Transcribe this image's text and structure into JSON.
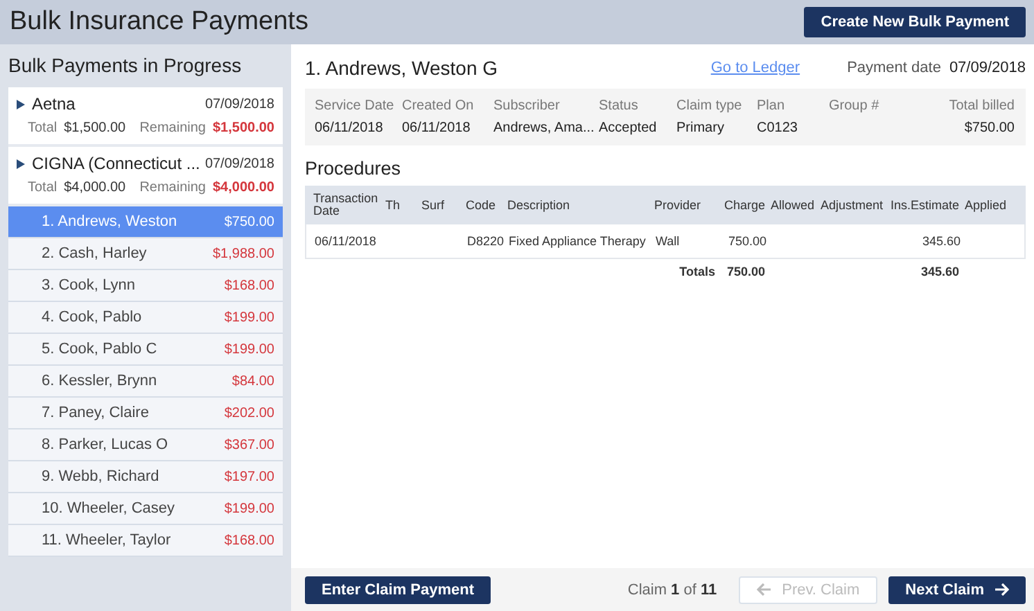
{
  "header": {
    "title": "Bulk Insurance Payments",
    "create_button": "Create New Bulk Payment"
  },
  "sidebar": {
    "title": "Bulk Payments in Progress",
    "groups": [
      {
        "name": "Aetna",
        "date": "07/09/2018",
        "total_label": "Total",
        "total": "$1,500.00",
        "remaining_label": "Remaining",
        "remaining": "$1,500.00",
        "expanded": false
      },
      {
        "name": "CIGNA (Connecticut ...",
        "date": "07/09/2018",
        "total_label": "Total",
        "total": "$4,000.00",
        "remaining_label": "Remaining",
        "remaining": "$4,000.00",
        "expanded": false
      }
    ],
    "claims": [
      {
        "name": "1. Andrews, Weston",
        "amount": "$750.00",
        "selected": true
      },
      {
        "name": "2. Cash, Harley",
        "amount": "$1,988.00",
        "selected": false
      },
      {
        "name": "3. Cook, Lynn",
        "amount": "$168.00",
        "selected": false
      },
      {
        "name": "4. Cook, Pablo",
        "amount": "$199.00",
        "selected": false
      },
      {
        "name": "5. Cook, Pablo C",
        "amount": "$199.00",
        "selected": false
      },
      {
        "name": "6. Kessler, Brynn",
        "amount": "$84.00",
        "selected": false
      },
      {
        "name": "7. Paney, Claire",
        "amount": "$202.00",
        "selected": false
      },
      {
        "name": "8. Parker, Lucas O",
        "amount": "$367.00",
        "selected": false
      },
      {
        "name": "9. Webb, Richard",
        "amount": "$197.00",
        "selected": false
      },
      {
        "name": "10. Wheeler, Casey",
        "amount": "$199.00",
        "selected": false
      },
      {
        "name": "11. Wheeler, Taylor",
        "amount": "$168.00",
        "selected": false
      }
    ]
  },
  "claim": {
    "patient": "1. Andrews, Weston G",
    "ledger_link": "Go to Ledger",
    "payment_date_label": "Payment date",
    "payment_date": "07/09/2018",
    "fields": [
      {
        "label": "Service Date",
        "value": "06/11/2018"
      },
      {
        "label": "Created On",
        "value": "06/11/2018"
      },
      {
        "label": "Subscriber",
        "value": "Andrews, Ama..."
      },
      {
        "label": "Status",
        "value": "Accepted"
      },
      {
        "label": "Claim type",
        "value": "Primary"
      },
      {
        "label": "Plan",
        "value": "C0123"
      },
      {
        "label": "Group #"
      },
      {
        "label": "Total billed",
        "value": "$750.00"
      }
    ]
  },
  "procedures": {
    "title": "Procedures",
    "columns": [
      "Transaction Date",
      "Th",
      "Surf",
      "Code",
      "Description",
      "Provider",
      "Charge",
      "Allowed",
      "Adjustment",
      "Ins.Estimate",
      "Applied"
    ],
    "rows": [
      [
        "06/11/2018",
        "",
        "",
        "D8220",
        "Fixed Appliance Therapy",
        "Wall",
        "750.00",
        "",
        "",
        "345.60",
        ""
      ]
    ],
    "totals": {
      "label": "Totals",
      "charge": "750.00",
      "ins_estimate": "345.60"
    }
  },
  "footer": {
    "enter_button": "Enter Claim Payment",
    "counter": "Claim **1** of **11**",
    "prev": {
      "label": "Prev. Claim",
      "disabled": true
    },
    "next": {
      "label": "Next Claim",
      "disabled": false
    }
  }
}
